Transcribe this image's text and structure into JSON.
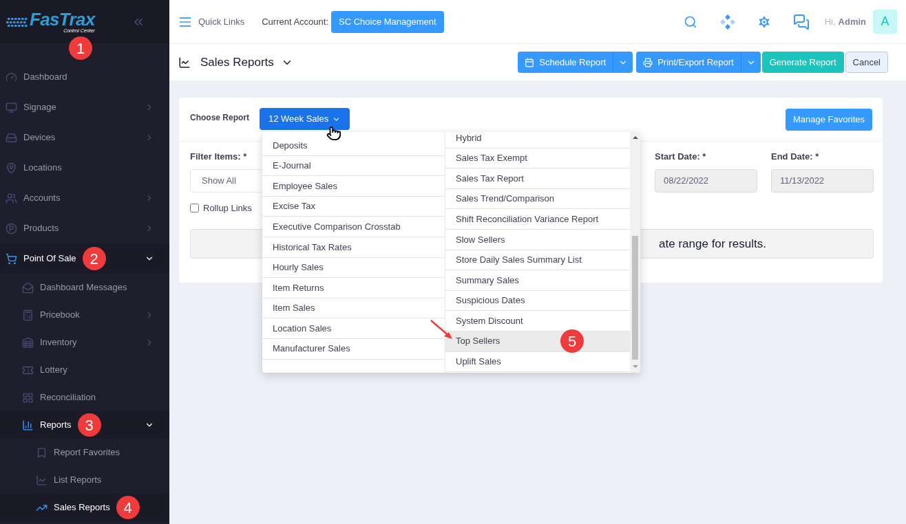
{
  "logo": {
    "name": "FasTrax",
    "tagline": "Control Center",
    "callout": "1"
  },
  "sidebar": {
    "items": [
      {
        "label": "Dashboard",
        "selected": false
      },
      {
        "label": "Signage",
        "expanded": false,
        "selected": false
      },
      {
        "label": "Devices",
        "expanded": false,
        "selected": false
      },
      {
        "label": "Locations",
        "selected": false
      },
      {
        "label": "Accounts",
        "expanded": false,
        "selected": false
      },
      {
        "label": "Products",
        "expanded": false,
        "selected": false
      },
      {
        "label": "Point Of Sale",
        "expanded": true,
        "selected": true,
        "callout": "2",
        "children": [
          {
            "label": "Dashboard Messages",
            "selected": false
          },
          {
            "label": "Pricebook",
            "expanded": false,
            "selected": false
          },
          {
            "label": "Inventory",
            "expanded": false,
            "selected": false
          },
          {
            "label": "Lottery",
            "selected": false
          },
          {
            "label": "Reconciliation",
            "selected": false
          },
          {
            "label": "Reports",
            "expanded": true,
            "selected": true,
            "callout": "3",
            "children": [
              {
                "label": "Report Favorites",
                "selected": false
              },
              {
                "label": "List Reports",
                "selected": false
              },
              {
                "label": "Sales Reports",
                "selected": true,
                "callout": "4"
              }
            ]
          }
        ]
      }
    ]
  },
  "topbar": {
    "quick_links": "Quick Links",
    "account_label": "Current Account:",
    "account": "SC Choice Management",
    "greeting": "Hi,",
    "user": "Admin",
    "avatar": "A"
  },
  "page_header": {
    "title": "Sales Reports",
    "buttons": [
      {
        "label": "Schedule Report",
        "kind": "split"
      },
      {
        "label": "Print/Export Report",
        "kind": "split"
      },
      {
        "label": "Generate Report",
        "kind": "primary"
      },
      {
        "label": "Cancel",
        "kind": "cancel"
      }
    ]
  },
  "report_card": {
    "choose_label": "Choose Report",
    "report": "12 Week Sales",
    "manage_favorites": "Manage Favorites",
    "filter_label": "Filter Items: *",
    "filter_value": "Show All",
    "rollup": {
      "label": "Rollup Links",
      "checked": false
    },
    "start_label": "Start Date: *",
    "start_date": "08/22/2022",
    "end_label": "End Date: *",
    "end_date": "11/13/2022",
    "message": "ate range for results."
  },
  "report_menu": {
    "columns": [
      [
        {
          "label": "Deposits",
          "selected": false
        },
        {
          "label": "E-Journal",
          "selected": false
        },
        {
          "label": "Employee Sales",
          "selected": false
        },
        {
          "label": "Excise Tax",
          "selected": false
        },
        {
          "label": "Executive Comparison Crosstab",
          "selected": false
        },
        {
          "label": "Historical Tax Rates",
          "selected": false
        },
        {
          "label": "Hourly Sales",
          "selected": false
        },
        {
          "label": "Item Returns",
          "selected": false
        },
        {
          "label": "Item Sales",
          "selected": false
        },
        {
          "label": "Location Sales",
          "selected": false
        },
        {
          "label": "Manufacturer Sales",
          "selected": false
        }
      ],
      [
        {
          "label": "Hybrid",
          "selected": false
        },
        {
          "label": "Sales Tax Exempt",
          "selected": false
        },
        {
          "label": "Sales Tax Report",
          "selected": false
        },
        {
          "label": "Sales Trend/Comparison",
          "selected": false
        },
        {
          "label": "Shift Reconciliation Variance Report",
          "selected": false
        },
        {
          "label": "Slow Sellers",
          "selected": false
        },
        {
          "label": "Store Daily Sales Summary List",
          "selected": false
        },
        {
          "label": "Summary Sales",
          "selected": false
        },
        {
          "label": "Suspicious Dates",
          "selected": false
        },
        {
          "label": "System Discount",
          "selected": false
        },
        {
          "label": "Top Sellers",
          "selected": true,
          "callout": "5",
          "arrow": true
        },
        {
          "label": "Uplift Sales",
          "selected": false
        }
      ]
    ]
  }
}
